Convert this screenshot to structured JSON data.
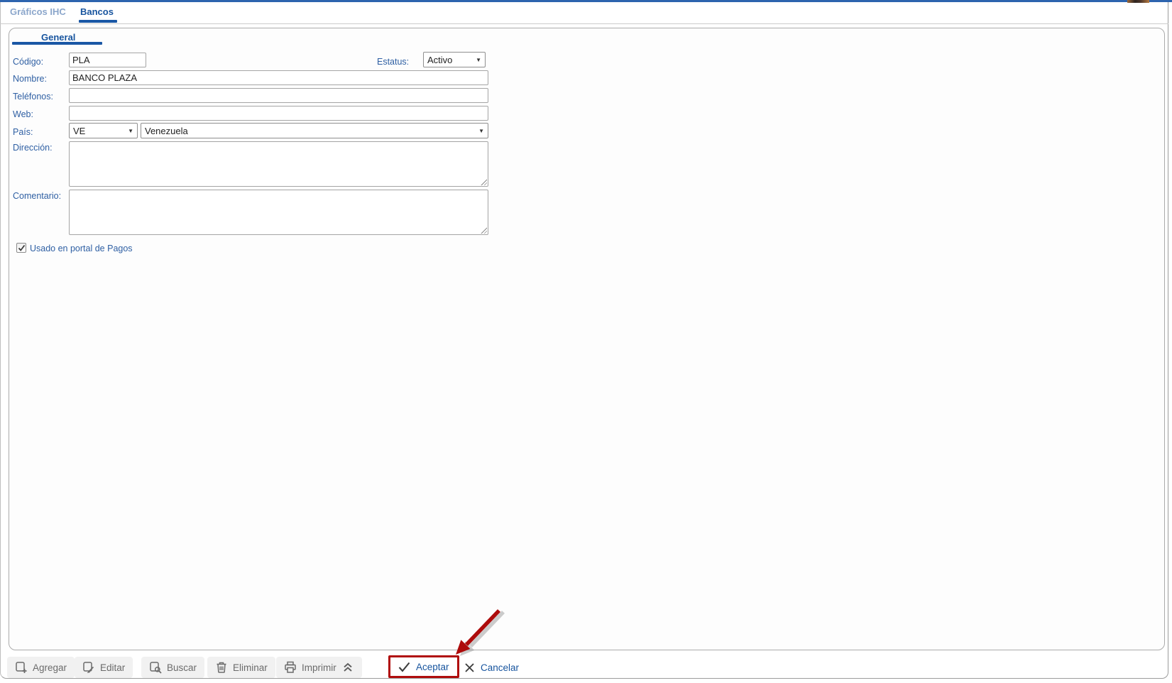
{
  "app": {
    "tabs": [
      {
        "label": "Gráficos IHC",
        "active": false
      },
      {
        "label": "Bancos",
        "active": true
      }
    ],
    "subtab_label": "General"
  },
  "form": {
    "codigo_label": "Código:",
    "codigo_value": "PLA",
    "estatus_label": "Estatus:",
    "estatus_value": "Activo",
    "nombre_label": "Nombre:",
    "nombre_value": "BANCO PLAZA",
    "telefonos_label": "Teléfonos:",
    "telefonos_value": "",
    "web_label": "Web:",
    "web_value": "",
    "pais_label": "País:",
    "pais_code": "VE",
    "pais_name": "Venezuela",
    "direccion_label": "Dirección:",
    "direccion_value": "",
    "comentario_label": "Comentario:",
    "comentario_value": "",
    "portal_checkbox_label": "Usado en portal de Pagos",
    "portal_checkbox_checked": true
  },
  "toolbar": {
    "buttons": [
      {
        "label": "Agregar",
        "icon": "add-document-icon"
      },
      {
        "label": "Editar",
        "icon": "edit-document-icon"
      },
      {
        "label": "Buscar",
        "icon": "search-document-icon"
      },
      {
        "label": "Eliminar",
        "icon": "trash-icon"
      },
      {
        "label": "Imprimir",
        "icon": "printer-icon"
      }
    ],
    "collapse_icon": "double-chevron-up-icon",
    "aceptar_label": "Aceptar",
    "cancelar_label": "Cancelar",
    "highlighted_button": "Aceptar"
  },
  "colors": {
    "accent_blue": "#1a57a5",
    "active_tab_text": "#17549e",
    "inactive_tab_text": "#8ba6cb",
    "label_blue": "#2e5fa3",
    "highlight_red": "#b00d0d",
    "toolbar_text_gray": "#6b6b6b",
    "top_strip_blue": "#2d64ae"
  },
  "annotation": {
    "type": "red-arrow",
    "points_to": "aceptar-button"
  }
}
